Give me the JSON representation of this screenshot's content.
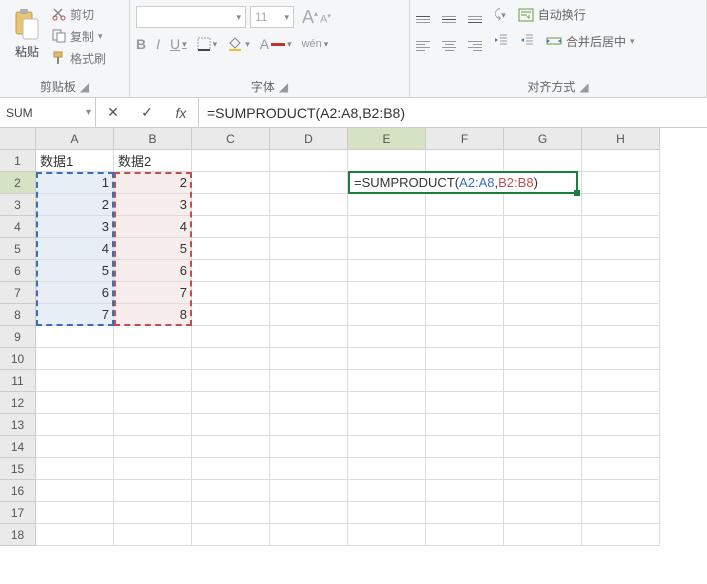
{
  "ribbon": {
    "clipboard": {
      "paste_label": "粘贴",
      "cut_label": "剪切",
      "copy_label": "复制",
      "format_painter_label": "格式刷",
      "group_label": "剪贴板"
    },
    "font": {
      "font_name": "",
      "font_size": "11",
      "bold": "B",
      "italic": "I",
      "underline": "U",
      "pinyin": "wén",
      "group_label": "字体"
    },
    "align": {
      "wrap_label": "自动换行",
      "merge_label": "合并后居中",
      "group_label": "对齐方式"
    }
  },
  "formula_bar": {
    "name_box": "SUM",
    "formula": "=SUMPRODUCT(A2:A8,B2:B8)"
  },
  "grid": {
    "columns": [
      "A",
      "B",
      "C",
      "D",
      "E",
      "F",
      "G",
      "H"
    ],
    "rows": [
      "1",
      "2",
      "3",
      "4",
      "5",
      "6",
      "7",
      "8",
      "9",
      "10",
      "11",
      "12",
      "13",
      "14",
      "15",
      "16",
      "17",
      "18"
    ],
    "headers": {
      "A": "数据1",
      "B": "数据2"
    },
    "colA": [
      "1",
      "2",
      "3",
      "4",
      "5",
      "6",
      "7"
    ],
    "colB": [
      "2",
      "3",
      "4",
      "5",
      "6",
      "7",
      "8"
    ]
  },
  "edit": {
    "prefix": "=SUMPRODUCT(",
    "rangeA": "A2:A8",
    "sep": ",",
    "rangeB": "B2:B8",
    "suffix": ")"
  },
  "chart_data": {
    "type": "table",
    "columns": [
      "数据1",
      "数据2"
    ],
    "rows": [
      [
        1,
        2
      ],
      [
        2,
        3
      ],
      [
        3,
        4
      ],
      [
        4,
        5
      ],
      [
        5,
        6
      ],
      [
        6,
        7
      ],
      [
        7,
        8
      ]
    ],
    "formula_cell": {
      "address": "E2",
      "formula": "=SUMPRODUCT(A2:A8,B2:B8)"
    }
  }
}
